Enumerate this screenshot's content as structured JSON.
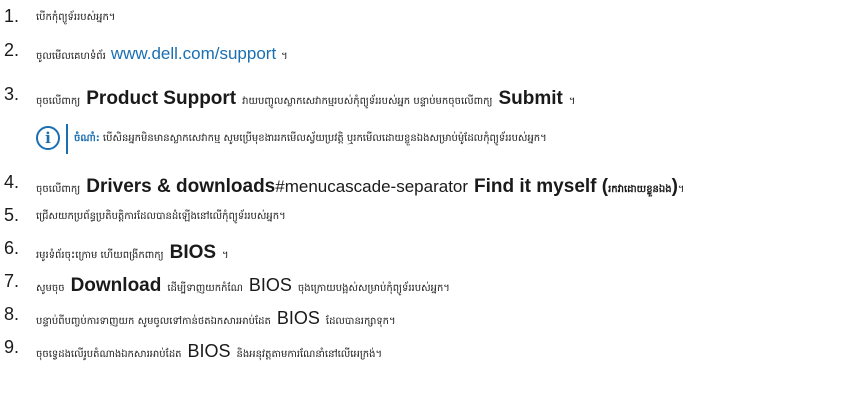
{
  "steps": [
    {
      "num": "1.",
      "parts": [
        "បើកកុំព្យូទ័ររបស់អ្នក។"
      ]
    },
    {
      "num": "2.",
      "parts": [
        "ចូលមើលគេហទំព័រ",
        "www.dell.com/support",
        "។"
      ]
    },
    {
      "num": "3.",
      "parts": [
        "ចុចលើពាក្យ",
        "Product Support",
        "វាយបញ្ចូលស្លាកសេវាកម្មរបស់កុំព្យូទ័ររបស់អ្នក បន្ទាប់មកចុចលើពាក្យ",
        "Submit",
        "។"
      ]
    },
    {
      "num": "4.",
      "parts": [
        "ចុចលើពាក្យ",
        "Drivers & downloads",
        "#menucascade-separator",
        "Find it myself (",
        "រកវាដោយខ្លួនឯង",
        ")",
        "។"
      ]
    },
    {
      "num": "5.",
      "parts": [
        "ជ្រើសយកប្រព័ន្ធប្រតិបត្តិការដែលបានដំឡើងនៅលើកុំព្យូទ័ររបស់អ្នក។"
      ]
    },
    {
      "num": "6.",
      "parts": [
        "រមូរទំព័រចុះក្រោម ហើយពង្រីកពាក្យ",
        "BIOS",
        "។"
      ]
    },
    {
      "num": "7.",
      "parts": [
        "សូមចុច",
        "Download",
        "ដើម្បីទាញយកកំណែ",
        "BIOS",
        "ចុងក្រោយបង្អស់សម្រាប់កុំព្យូទ័ររបស់អ្នក។"
      ]
    },
    {
      "num": "8.",
      "parts": [
        "បន្ទាប់ពីបញ្ចប់ការទាញយក សូមចូលទៅកាន់ថតឯកសារអាប់ដែត",
        "BIOS",
        "ដែលបានរក្សាទុក។"
      ]
    },
    {
      "num": "9.",
      "parts": [
        "ចុចទ្វេដងលើរូបតំណាងឯកសារអាប់ដែត",
        "BIOS",
        "និងអនុវត្តតាមការណែនាំនៅលើអេក្រង់។"
      ]
    }
  ],
  "note": {
    "icon": "info-icon",
    "label": "ចំណាំ:",
    "text": "បើសិនអ្នកមិនមានស្លាកសេវាកម្ម សូមប្រើមុខងាររកមើលស្វ័យប្រវត្តិ ឬរកមើលដោយខ្លួនឯងសម្រាប់ម៉ូដែលកុំព្យូទ័ររបស់អ្នក។"
  },
  "colors": {
    "link": "#1a6fb3",
    "text": "#1a1a1a"
  }
}
